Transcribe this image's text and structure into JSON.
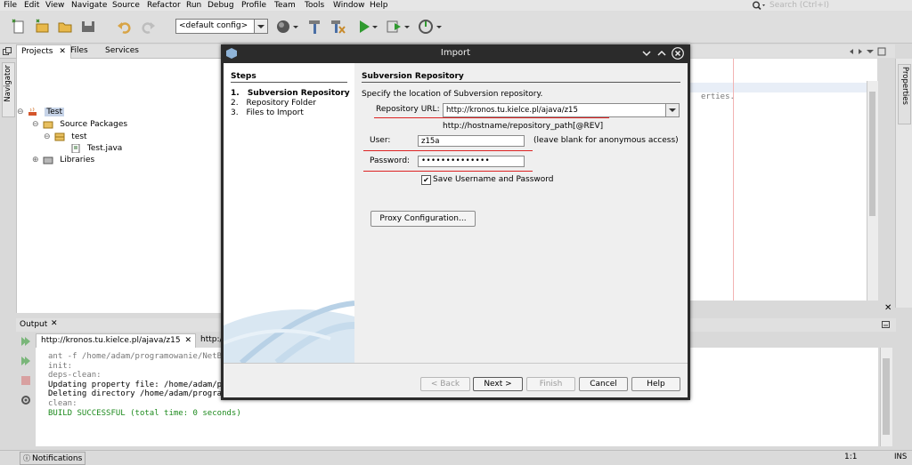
{
  "menu": [
    "File",
    "Edit",
    "View",
    "Navigate",
    "Source",
    "Refactor",
    "Run",
    "Debug",
    "Profile",
    "Team",
    "Tools",
    "Window",
    "Help"
  ],
  "search": {
    "placeholder": "Search (Ctrl+I)"
  },
  "toolbar": {
    "config": "<default config>"
  },
  "left_panel": {
    "tabs": [
      "Projects",
      "Files",
      "Services"
    ],
    "navigator_label": "Navigator",
    "tree": {
      "project": "Test",
      "source_packages": "Source Packages",
      "package": "test",
      "file": "Test.java",
      "libraries": "Libraries"
    }
  },
  "editor": {
    "fragment": "erties."
  },
  "right_strip": {
    "label": "Properties"
  },
  "dialog": {
    "title": "Import",
    "steps_title": "Steps",
    "steps": [
      {
        "num": "1.",
        "label": "Subversion Repository"
      },
      {
        "num": "2.",
        "label": "Repository Folder"
      },
      {
        "num": "3.",
        "label": "Files to Import"
      }
    ],
    "section_title": "Subversion Repository",
    "description": "Specify the location of Subversion repository.",
    "repo_url_label": "Repository URL:",
    "repo_url_value": "http://kronos.tu.kielce.pl/ajava/z15",
    "repo_url_hint": "http://hostname/repository_path[@REV]",
    "user_label": "User:",
    "user_value": "z15a",
    "user_hint": "(leave blank for anonymous access)",
    "password_label": "Password:",
    "password_value": "••••••••••••••",
    "save_label": "Save Username and Password",
    "proxy_button": "Proxy Configuration...",
    "buttons": {
      "back": "< Back",
      "next": "Next >",
      "finish": "Finish",
      "cancel": "Cancel",
      "help": "Help"
    }
  },
  "output": {
    "title": "Output",
    "tabs": [
      "http://kronos.tu.kielce.pl/ajava/z15",
      "http:/"
    ],
    "lines": [
      "ant -f /home/adam/programowanie/NetBe",
      "init:",
      "deps-clean:",
      "Updating property file: /home/adam/pr",
      "Deleting directory /home/adam/program",
      "clean:",
      "BUILD SUCCESSFUL (total time: 0 seconds)"
    ]
  },
  "status": {
    "notifications": "Notifications",
    "position": "1:1",
    "mode": "INS"
  }
}
